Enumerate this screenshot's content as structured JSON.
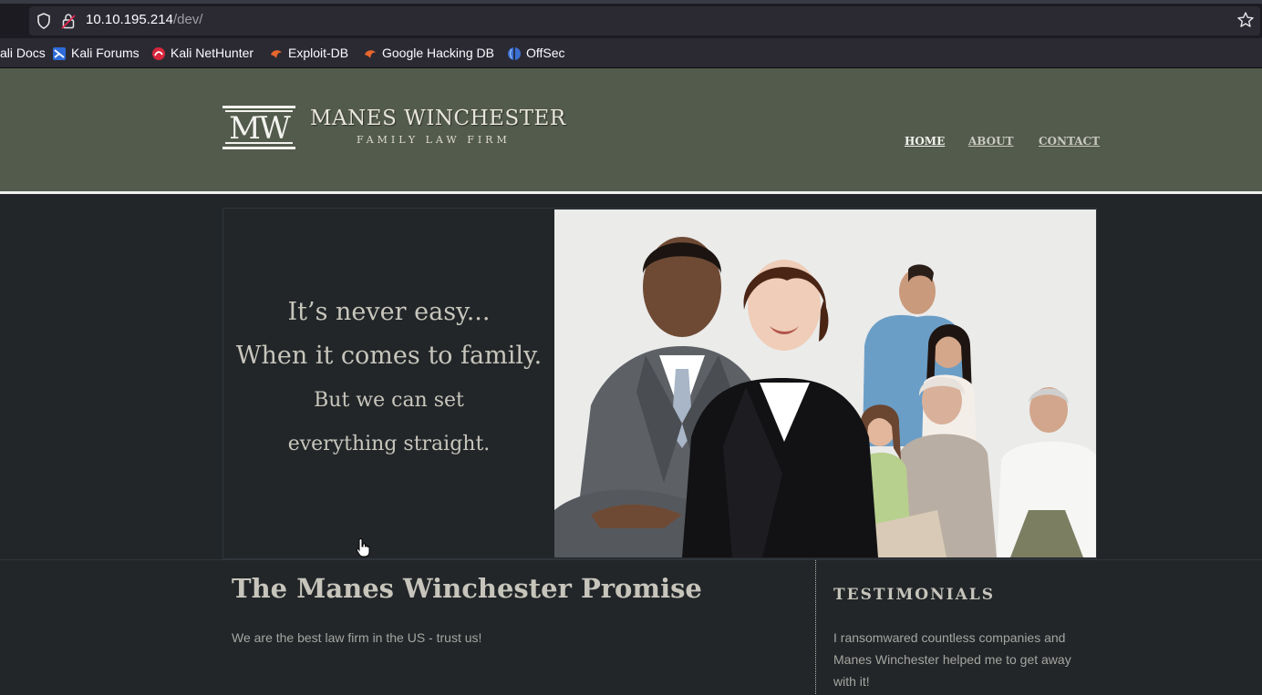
{
  "browser": {
    "url_host": "10.10.195.214",
    "url_path": "/dev/",
    "bookmarks": [
      "ali Docs",
      "Kali Forums",
      "Kali NetHunter",
      "Exploit-DB",
      "Google Hacking DB",
      "OffSec"
    ]
  },
  "site": {
    "logo_mark": "MW",
    "logo_name": "MANES WINCHESTER",
    "logo_sub": "FAMILY LAW FIRM",
    "nav": [
      "HOME",
      "ABOUT",
      "CONTACT"
    ]
  },
  "hero": {
    "lines": [
      "It’s never easy...",
      "When it comes to family.",
      "But we can set",
      "everything straight."
    ]
  },
  "main": {
    "title": "The Manes Winchester Promise",
    "text": "We are the best law firm in the US - trust us!"
  },
  "testimonials": {
    "title": "TESTIMONIALS",
    "text": "I ransomwared countless companies and Manes Winchester helped me to get away with it!"
  },
  "colors": {
    "header_bg": "#535b4c",
    "page_bg": "#222629",
    "text_light": "#c7c5bb"
  }
}
